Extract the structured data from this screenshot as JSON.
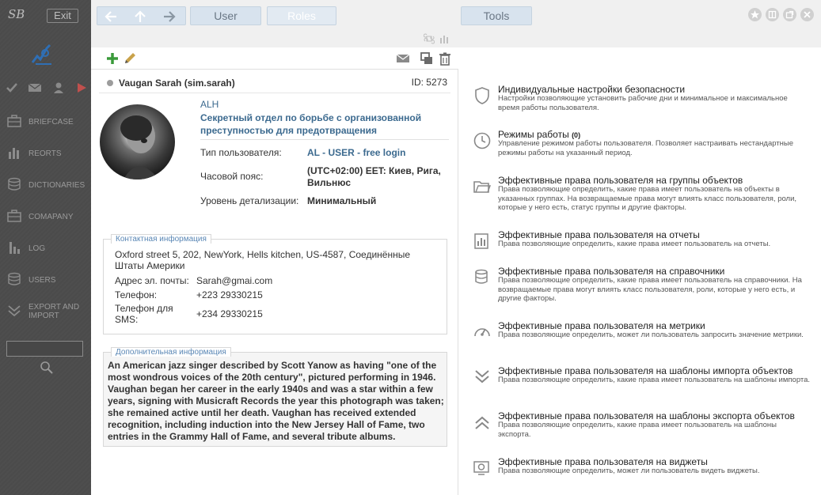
{
  "app": {
    "logo_text": "SB",
    "exit_label": "Exit"
  },
  "quick_icons": [
    "check-icon",
    "mail-icon",
    "person-icon",
    "play-icon"
  ],
  "sidebar": {
    "items": [
      {
        "label": "BRIEFCASE",
        "icon": "briefcase-icon"
      },
      {
        "label": "REORTS",
        "icon": "bar-chart-icon"
      },
      {
        "label": "DICTIONARIES",
        "icon": "database-icon"
      },
      {
        "label": "COMAPANY",
        "icon": "briefcase-icon"
      },
      {
        "label": "LOG",
        "icon": "log-icon"
      },
      {
        "label": "USERS",
        "icon": "database-icon"
      },
      {
        "label": "EXPORT AND IMPORT",
        "icon": "chevrons-down-icon"
      }
    ],
    "search_value": ""
  },
  "topbar": {
    "tabs": {
      "user": "User",
      "roles": "Roles",
      "tools": "Tools"
    }
  },
  "user": {
    "name": "Vaugan Sarah (sim.sarah)",
    "id_label": "ID: 5273",
    "dept_code": "ALH",
    "dept_name": "Секретный отдел по борьбе с организованной преступностью для предотвращения",
    "props": [
      {
        "label": "Тип пользователя:",
        "value": "AL - USER - free login",
        "link": true
      },
      {
        "label": "Часовой пояс:",
        "value": "(UTC+02:00) EET: Киев, Рига, Вильнюс",
        "link": false
      },
      {
        "label": "Уровень детализации:",
        "value": "Минимальный",
        "link": false
      }
    ]
  },
  "contact": {
    "legend": "Контактная информация",
    "address": "Oxford street 5, 202, NewYork, Hells kitchen, US-4587, Соединённые Штаты Америки",
    "rows": [
      {
        "label": "Адрес эл. почты:",
        "value": "Sarah@gmai.com"
      },
      {
        "label": "Телефон:",
        "value": "+223 29330215"
      },
      {
        "label": "Телефон для SMS:",
        "value": "+234 29330215"
      }
    ]
  },
  "extra": {
    "legend": "Дополнительная информация",
    "bio": "An American jazz singer described by Scott Yanow as having \"one of the most wondrous voices of the 20th century\", pictured performing in 1946. Vaughan began her career in the early 1940s and was a star within a few years, signing with Musicraft Records the year this photograph was taken; she remained active until her death. Vaughan has received extended recognition, including induction into the New Jersey Hall of Fame, two entries in the Grammy Hall of Fame, and several tribute albums."
  },
  "tools": [
    {
      "title": "Индивидуальные настройки безопасности",
      "badge": "",
      "desc": "Настройки позволяющие установить рабочие дни и минимальное и максимальное время работы пользователя.",
      "icon": "shield-icon"
    },
    {
      "title": "Режимы работы",
      "badge": "(0)",
      "desc": "Управление режимом работы пользователя. Позволяет настраивать нестандартные режимы работы на указанный период.",
      "icon": "clock-icon"
    },
    {
      "title": "Эффективные права пользователя на группы объектов",
      "badge": "",
      "desc": "Права позволяющие определить, какие права имеет пользователь на объекты в указанных группах. На возвращаемые права могут влиять класс пользователя, роли, которые у него есть, статус группы и другие факторы.",
      "icon": "folder-icon"
    },
    {
      "title": "Эффективные права пользователя на отчеты",
      "badge": "",
      "desc": "Права позволяющие определить, какие права имеет пользователь на отчеты.",
      "icon": "report-icon"
    },
    {
      "title": "Эффективные права пользователя на справочники",
      "badge": "",
      "desc": "Права позволяющие определить, какие права имеет пользователь на справочники. На возвращаемые права могут влиять класс пользователя, роли, которые у него есть, и другие факторы.",
      "icon": "database-icon"
    },
    {
      "title": "Эффективные права пользователя на метрики",
      "badge": "",
      "desc": "Права позволяющие определить, может ли пользователь запросить значение метрики.",
      "icon": "gauge-icon"
    },
    {
      "title": "Эффективные права пользователя на шаблоны импорта объектов",
      "badge": "",
      "desc": "Права позволяющие определить, какие права имеет пользователь на шаблоны импорта.",
      "icon": "import-icon"
    },
    {
      "title": "Эффективные права пользователя на шаблоны экспорта объектов",
      "badge": "",
      "desc": "Права позволяющие определить, какие права имеет пользователь на шаблоны экспорта.",
      "icon": "export-icon"
    },
    {
      "title": "Эффективные права пользователя на виджеты",
      "badge": "",
      "desc": "Права позволяющие определить, может ли пользователь видеть виджеты.",
      "icon": "widget-icon"
    }
  ]
}
